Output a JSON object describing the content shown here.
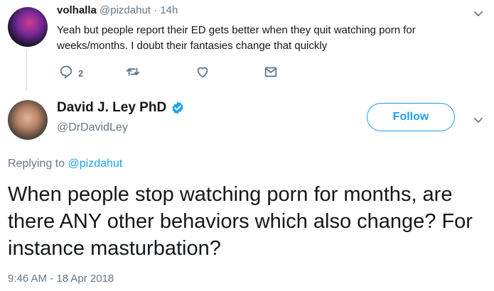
{
  "reply_tweet": {
    "name": "volhalla",
    "handle": "@pizdahut",
    "separator": "·",
    "time": "14h",
    "text": "Yeah but people report their ED gets better when they quit watching porn for weeks/months. I doubt their fantasies change that quickly",
    "reply_count": "2",
    "icons": [
      "reply-icon",
      "retweet-icon",
      "like-icon",
      "direct-message-icon",
      "chevron-down-icon"
    ]
  },
  "main_tweet": {
    "name": "David J. Ley PhD",
    "handle": "@DrDavidLey",
    "verified": true,
    "follow_label": "Follow",
    "replying_prefix": "Replying to",
    "replying_to": "@pizdahut",
    "text": "When people stop watching porn for months, are there ANY other behaviors which also change? For instance masturbation?",
    "timestamp": "9:46 AM - 18 Apr 2018"
  },
  "colors": {
    "accent": "#1da1f2",
    "secondary_text": "#657786",
    "primary_text": "#14171a",
    "thread_line": "#e1e8ed"
  }
}
